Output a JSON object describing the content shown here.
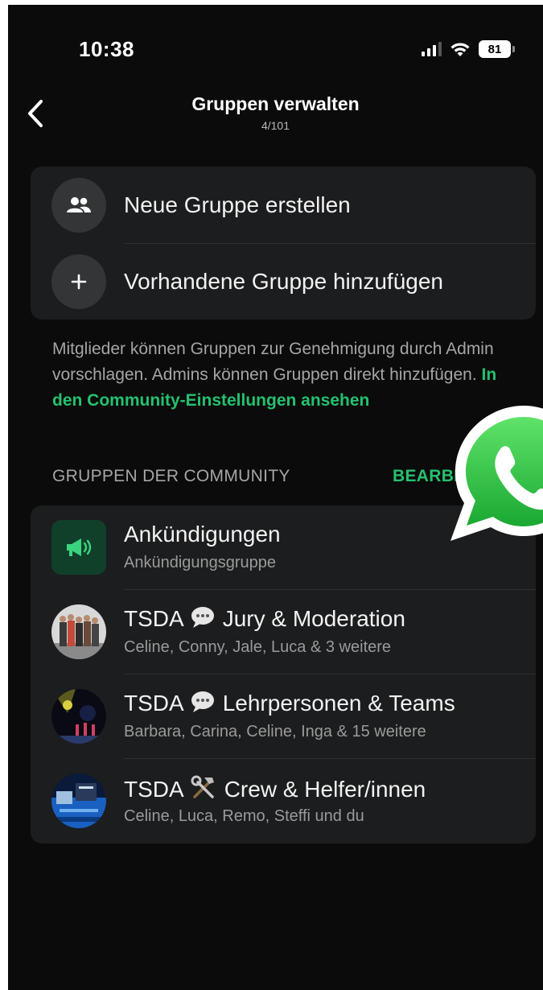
{
  "status_bar": {
    "time": "10:38",
    "battery": "81"
  },
  "header": {
    "title": "Gruppen verwalten",
    "subtitle": "4/101"
  },
  "actions": [
    {
      "label": "Neue Gruppe erstellen",
      "icon": "group-icon"
    },
    {
      "label": "Vorhandene Gruppe hinzufügen",
      "icon": "plus-icon"
    }
  ],
  "info": {
    "text": "Mitglieder können Gruppen zur Genehmigung durch Admin vorschlagen. Admins können Gruppen direkt hinzufügen. ",
    "link": "In den Community-Einstellungen ansehen"
  },
  "section": {
    "heading": "GRUPPEN DER COMMUNITY",
    "edit": "BEARBEITEN"
  },
  "groups": [
    {
      "name": "Ankündigungen",
      "sub": "Ankündigungsgruppe"
    },
    {
      "name_a": "TSDA",
      "name_b": "Jury & Moderation",
      "sub": "Celine, Conny, Jale, Luca & 3 weitere",
      "emoji": "speech-bubble-icon"
    },
    {
      "name_a": "TSDA",
      "name_b": "Lehrpersonen & Teams",
      "sub": "Barbara, Carina, Celine, Inga & 15 weitere",
      "emoji": "speech-bubble-icon"
    },
    {
      "name_a": "TSDA",
      "name_b": "Crew & Helfer/innen",
      "sub": "Celine, Luca, Remo, Steffi und du",
      "emoji": "hammer-wrench-icon"
    }
  ],
  "colors": {
    "accent": "#25c16f",
    "background": "#0b0b0b",
    "card": "#1c1d1e"
  }
}
